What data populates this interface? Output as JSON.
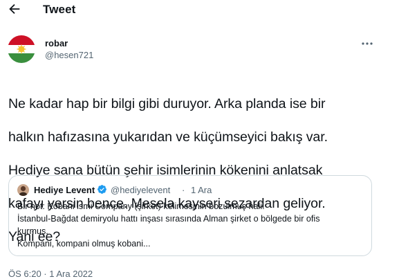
{
  "header": {
    "title": "Tweet"
  },
  "tweet": {
    "author_name": "robar",
    "author_handle": "@hesen721",
    "text_lines": [
      "Ne kadar  hap bir bilgi gibi duruyor. Arka planda ise bir",
      "halkın hafızasına yukarıdan ve küçümseyici bakış var.",
      "Hediye sana bütün şehir isimlerinin kökenini anlatsak",
      "kafayı yersin bence. Mesela kayseri sezardan geliyor.",
      "Yani ee?"
    ],
    "timestamp": "ÖS 6:20 · 1 Ara 2022"
  },
  "quote": {
    "author_name": "Hediye Levent",
    "author_handle": "@hediyelevent",
    "separator": "·",
    "date": "1 Ara",
    "text_lines": [
      "Bir not: Kobani ismi Company (şirket) kelimesinin bozulmuş hali.",
      "İstanbul-Bağdat demiryolu hattı inşası sırasında Alman şirket o bölgede bir ofis",
      "kurmuş.",
      "Kompani, kompani olmuş kobani..."
    ]
  },
  "colors": {
    "text_primary": "#0f1419",
    "text_secondary": "#536471",
    "border": "#cfd9de",
    "verified_blue": "#1d9bf0",
    "avatar_red": "#ce1126",
    "avatar_green": "#3a8f3e",
    "avatar_sun": "#f4c430"
  },
  "icons": {
    "back": "arrow-left-icon",
    "more": "more-horizontal-icon",
    "verified": "verified-badge-icon"
  }
}
